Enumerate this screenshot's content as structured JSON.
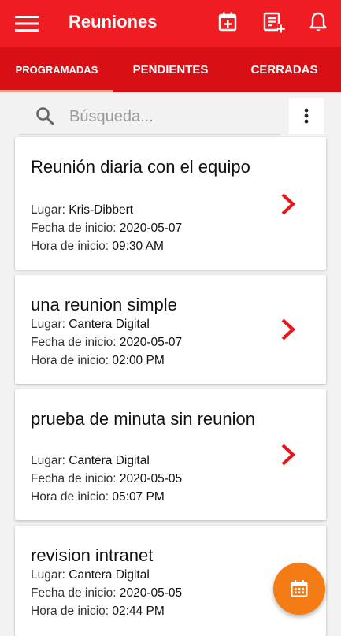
{
  "appbar": {
    "title": "Reuniones",
    "icons": [
      "menu-icon",
      "calendar-add-icon",
      "note-add-icon",
      "bell-icon"
    ]
  },
  "tabs": [
    {
      "label": "PROGRAMADAS",
      "active": true
    },
    {
      "label": "PENDIENTES",
      "active": false
    },
    {
      "label": "CERRADAS",
      "active": false
    }
  ],
  "search": {
    "placeholder": "Búsqueda..."
  },
  "labels": {
    "place": "Lugar:",
    "start_date": "Fecha de inicio:",
    "start_time": "Hora de inicio:"
  },
  "meetings": [
    {
      "title": "Reunión diaria con el equipo",
      "place": "Kris-Dibbert",
      "date": "2020-05-07",
      "time": "09:30 AM"
    },
    {
      "title": "una reunion simple",
      "place": "Cantera Digital",
      "date": "2020-05-07",
      "time": "02:00 PM"
    },
    {
      "title": "prueba de minuta sin reunion",
      "place": "Cantera Digital",
      "date": "2020-05-05",
      "time": "05:07 PM"
    },
    {
      "title": "revision intranet",
      "place": "Cantera Digital",
      "date": "2020-05-05",
      "time": "02:44 PM"
    }
  ],
  "colors": {
    "primary": "#ef1c22",
    "tabs": "#d81016",
    "fab": "#f57c14",
    "chevron": "#e8151b"
  }
}
